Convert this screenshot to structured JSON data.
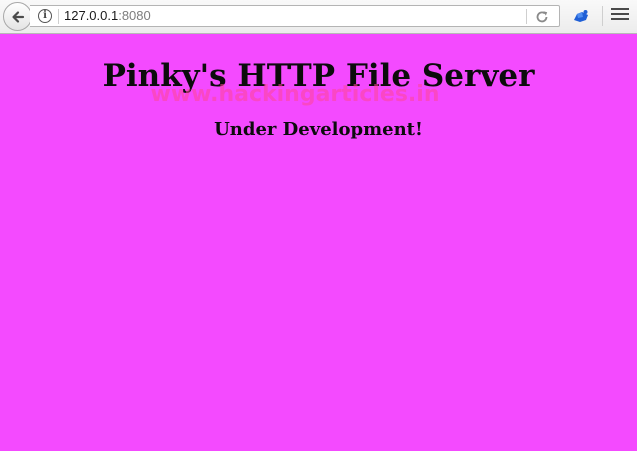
{
  "browser": {
    "url_host": "127.0.0.1",
    "url_port": ":8080",
    "icons": {
      "back": "back-arrow-icon",
      "info": "info-icon",
      "reload": "reload-icon",
      "extension": "extension-icon",
      "menu": "hamburger-menu-icon"
    },
    "info_glyph": "i"
  },
  "page": {
    "background": "#f44aff",
    "title": "Pinky's HTTP File Server",
    "watermark": "www.hackingarticles.in",
    "subtitle": "Under Development!"
  }
}
